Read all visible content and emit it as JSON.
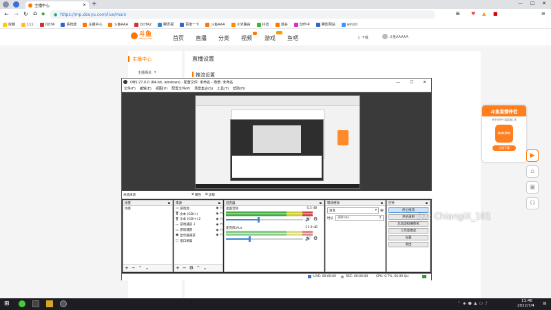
{
  "browser": {
    "tab_title": "主播中心",
    "url": "https://mp.douyu.com/live/main",
    "bookmarks": [
      "收藏",
      "111",
      "DOTA",
      "系统篇",
      "主播中心",
      "斗鱼AAA",
      "DOTA2",
      "腾讯视",
      "百度一下",
      "斗鱼AAA",
      "小米路由",
      "抖音",
      "道谷",
      "创作中",
      "腾影网站",
      "win10"
    ]
  },
  "site": {
    "logo": "斗鱼",
    "logo_sub": "douyu.com",
    "nav": [
      "首页",
      "直播",
      "分类",
      "视频",
      "游戏",
      "鱼吧"
    ],
    "download": "下载",
    "username": "斗鱼AAAAA",
    "sidebar_title": "主播中心",
    "sidebar_item": "主播相关",
    "main_title": "直播设置",
    "section_title": "推流设置",
    "promo_title": "斗鱼直播伴侣",
    "promo_sub": "虎牙创作PC端直播工具",
    "promo_btn": "立即下载",
    "promo_logo": "DOUYU"
  },
  "obs": {
    "title": "OBS 27.0.0 (64-bit, windows) - 配置文件: 未命名 - 场景: 未命名",
    "menu": [
      "文件(F)",
      "编辑(E)",
      "视图(V)",
      "配置文件(P)",
      "场景集合(S)",
      "工具(T)",
      "帮助(H)"
    ],
    "no_source": "未选择源",
    "props": "属性",
    "filters": "滤镜",
    "scenes_header": "场景",
    "scenes": [
      "场景"
    ],
    "sources_header": "来源",
    "sources": [
      {
        "name": "游戏源",
        "icon": "game-icon"
      },
      {
        "name": "文本 (GDI+)",
        "icon": "text-icon"
      },
      {
        "name": "文本 (GDI+) 2",
        "icon": "text-icon"
      },
      {
        "name": "游戏捕获 2",
        "icon": "game-icon"
      },
      {
        "name": "游戏捕获",
        "icon": "game-icon"
      },
      {
        "name": "显示器捕获",
        "icon": "monitor-icon"
      },
      {
        "name": "窗口采集",
        "icon": "window-icon"
      }
    ],
    "mixer_header": "混音器",
    "mixer": [
      {
        "name": "桌面音频",
        "db": "-5.5 dB",
        "level": 0.42
      },
      {
        "name": "麦克风/Aux",
        "db": "-11.9 dB",
        "level": 0.3
      }
    ],
    "transition_header": "转场特效",
    "transition_value": "渐变",
    "duration_label": "时长",
    "duration_value": "300 ms",
    "controls_header": "控件",
    "controls": [
      "停止推流",
      "开始录制",
      "启动虚拟摄像机",
      "工作室模式",
      "设置",
      "退出"
    ],
    "status": {
      "live": "LIVE: 00:00:00",
      "rec": "REC: 00:00:00",
      "cpu": "CPU: 0.7%, 60.00 fps"
    }
  },
  "watermark": "QX: ChiangiX_101",
  "taskbar": {
    "time": "11:46",
    "date": "2022/7/4"
  },
  "colors": {
    "brand": "#ff7700",
    "obs_bg": "#2b2b2b",
    "taskbar": "#1d1e22"
  }
}
